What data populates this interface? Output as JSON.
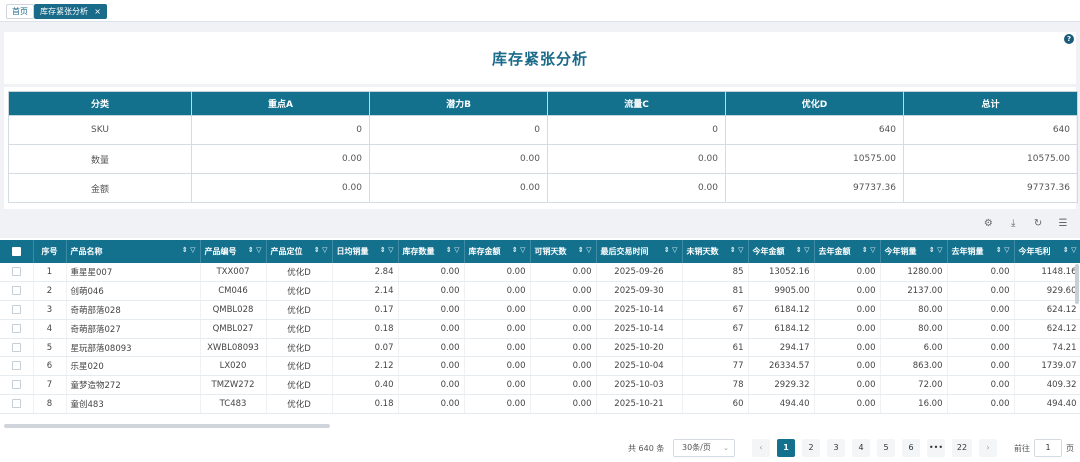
{
  "tabs": {
    "home": "首页",
    "active": "库存紧张分析",
    "close": "×"
  },
  "page": {
    "title": "库存紧张分析",
    "help": "?"
  },
  "summary": {
    "headers": [
      "分类",
      "重点A",
      "潜力B",
      "流量C",
      "优化D",
      "总计"
    ],
    "rows": [
      [
        "SKU",
        "0",
        "0",
        "0",
        "640",
        "640"
      ],
      [
        "数量",
        "0.00",
        "0.00",
        "0.00",
        "10575.00",
        "10575.00"
      ],
      [
        "金额",
        "0.00",
        "0.00",
        "0.00",
        "97737.36",
        "97737.36"
      ]
    ]
  },
  "toolbar": {
    "settings": "⚙",
    "download": "⤓",
    "refresh": "↻",
    "columns": "☰"
  },
  "table": {
    "sort_icon": "⇕ ▽",
    "headers": [
      "序号",
      "产品名称",
      "产品编号",
      "产品定位",
      "日均销量",
      "库存数量",
      "库存金额",
      "可销天数",
      "最后交易时间",
      "未销天数",
      "今年金额",
      "去年金额",
      "今年销量",
      "去年销量",
      "今年毛利",
      "去年毛"
    ],
    "rows": [
      [
        "1",
        "重星星007",
        "TXX007",
        "优化D",
        "2.84",
        "0.00",
        "0.00",
        "0.00",
        "2025-09-26",
        "85",
        "13052.16",
        "0.00",
        "1280.00",
        "0.00",
        "1148.16"
      ],
      [
        "2",
        "创萌046",
        "CM046",
        "优化D",
        "2.14",
        "0.00",
        "0.00",
        "0.00",
        "2025-09-30",
        "81",
        "9905.00",
        "0.00",
        "2137.00",
        "0.00",
        "929.60"
      ],
      [
        "3",
        "奇萌部落028",
        "QMBL028",
        "优化D",
        "0.17",
        "0.00",
        "0.00",
        "0.00",
        "2025-10-14",
        "67",
        "6184.12",
        "0.00",
        "80.00",
        "0.00",
        "624.12"
      ],
      [
        "4",
        "奇萌部落027",
        "QMBL027",
        "优化D",
        "0.18",
        "0.00",
        "0.00",
        "0.00",
        "2025-10-14",
        "67",
        "6184.12",
        "0.00",
        "80.00",
        "0.00",
        "624.12"
      ],
      [
        "5",
        "星玩部落08093",
        "XWBL08093",
        "优化D",
        "0.07",
        "0.00",
        "0.00",
        "0.00",
        "2025-10-20",
        "61",
        "294.17",
        "0.00",
        "6.00",
        "0.00",
        "74.21"
      ],
      [
        "6",
        "乐星020",
        "LX020",
        "优化D",
        "2.12",
        "0.00",
        "0.00",
        "0.00",
        "2025-10-04",
        "77",
        "26334.57",
        "0.00",
        "863.00",
        "0.00",
        "1739.07"
      ],
      [
        "7",
        "童梦造物272",
        "TMZW272",
        "优化D",
        "0.40",
        "0.00",
        "0.00",
        "0.00",
        "2025-10-03",
        "78",
        "2929.32",
        "0.00",
        "72.00",
        "0.00",
        "409.32"
      ],
      [
        "8",
        "童创483",
        "TC483",
        "优化D",
        "0.18",
        "0.00",
        "0.00",
        "0.00",
        "2025-10-21",
        "60",
        "494.40",
        "0.00",
        "16.00",
        "0.00",
        "494.40"
      ]
    ]
  },
  "pagination": {
    "total": "共 640 条",
    "page_size": "30条/页",
    "prev": "‹",
    "next": "›",
    "pages": [
      "1",
      "2",
      "3",
      "4",
      "5",
      "6",
      "•••",
      "22"
    ],
    "current": "1",
    "goto_label": "前往",
    "goto_value": "1",
    "goto_unit": "页"
  }
}
